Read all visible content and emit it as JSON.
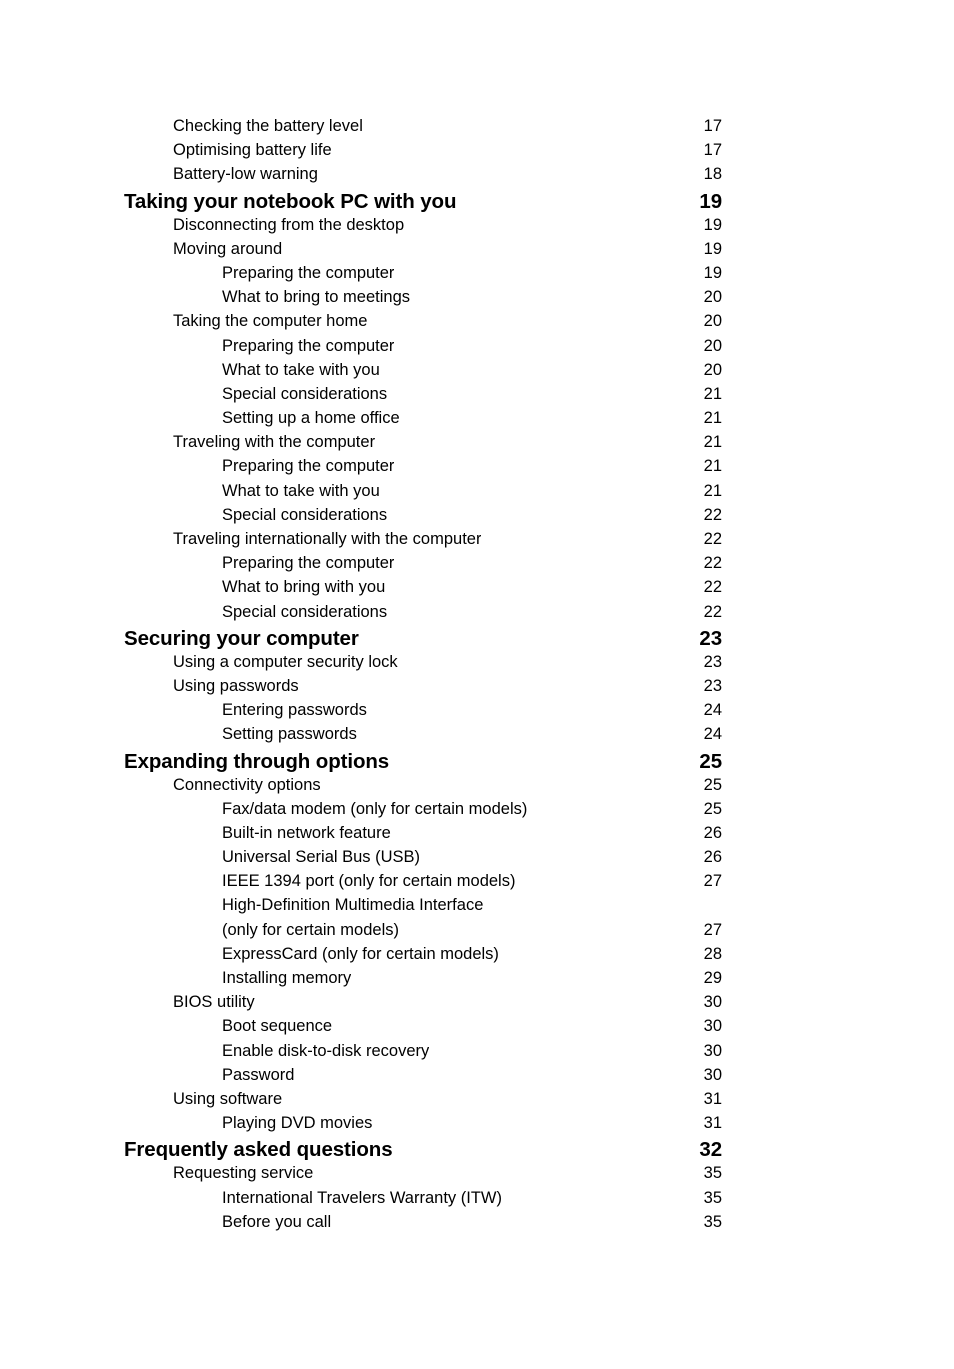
{
  "document": {
    "type": "table-of-contents",
    "text_color": "#000000",
    "background_color": "#ffffff"
  },
  "toc": {
    "entries": [
      {
        "level": 2,
        "title": "Checking the battery level",
        "page": "17"
      },
      {
        "level": 2,
        "title": "Optimising battery life",
        "page": "17"
      },
      {
        "level": 2,
        "title": "Battery-low warning",
        "page": "18"
      },
      {
        "level": 1,
        "title": "Taking your notebook PC with you",
        "page": "19"
      },
      {
        "level": 2,
        "title": "Disconnecting from the desktop",
        "page": "19"
      },
      {
        "level": 2,
        "title": "Moving around",
        "page": "19"
      },
      {
        "level": 3,
        "title": "Preparing the computer",
        "page": "19"
      },
      {
        "level": 3,
        "title": "What to bring to meetings",
        "page": "20"
      },
      {
        "level": 2,
        "title": "Taking the computer home",
        "page": "20"
      },
      {
        "level": 3,
        "title": "Preparing the computer",
        "page": "20"
      },
      {
        "level": 3,
        "title": "What to take with you",
        "page": "20"
      },
      {
        "level": 3,
        "title": "Special considerations",
        "page": "21"
      },
      {
        "level": 3,
        "title": "Setting up a home office",
        "page": "21"
      },
      {
        "level": 2,
        "title": "Traveling with the computer",
        "page": "21"
      },
      {
        "level": 3,
        "title": "Preparing the computer",
        "page": "21"
      },
      {
        "level": 3,
        "title": "What to take with you",
        "page": "21"
      },
      {
        "level": 3,
        "title": "Special considerations",
        "page": "22"
      },
      {
        "level": 2,
        "title": "Traveling internationally with the computer",
        "page": "22"
      },
      {
        "level": 3,
        "title": "Preparing the computer",
        "page": "22"
      },
      {
        "level": 3,
        "title": "What to bring with you",
        "page": "22"
      },
      {
        "level": 3,
        "title": "Special considerations",
        "page": "22"
      },
      {
        "level": 1,
        "title": "Securing your computer",
        "page": "23"
      },
      {
        "level": 2,
        "title": "Using a computer security lock",
        "page": "23"
      },
      {
        "level": 2,
        "title": "Using passwords",
        "page": "23"
      },
      {
        "level": 3,
        "title": "Entering passwords",
        "page": "24"
      },
      {
        "level": 3,
        "title": "Setting passwords",
        "page": "24"
      },
      {
        "level": 1,
        "title": "Expanding through options",
        "page": "25"
      },
      {
        "level": 2,
        "title": "Connectivity options",
        "page": "25"
      },
      {
        "level": 3,
        "title": "Fax/data modem (only for certain models)",
        "page": "25"
      },
      {
        "level": 3,
        "title": "Built-in network feature",
        "page": "26"
      },
      {
        "level": 3,
        "title": "Universal Serial Bus (USB)",
        "page": "26"
      },
      {
        "level": 3,
        "title": "IEEE 1394 port  (only for certain models)",
        "page": "27"
      },
      {
        "level": 3,
        "title": "High-Definition Multimedia Interface",
        "page": "",
        "wrapped": true
      },
      {
        "level": 3,
        "title": "(only for certain models)",
        "page": "27"
      },
      {
        "level": 3,
        "title": "ExpressCard (only for certain models)",
        "page": "28"
      },
      {
        "level": 3,
        "title": "Installing memory",
        "page": "29"
      },
      {
        "level": 2,
        "title": "BIOS utility",
        "page": "30"
      },
      {
        "level": 3,
        "title": "Boot sequence",
        "page": "30"
      },
      {
        "level": 3,
        "title": "Enable disk-to-disk recovery",
        "page": "30"
      },
      {
        "level": 3,
        "title": "Password",
        "page": "30"
      },
      {
        "level": 2,
        "title": "Using software",
        "page": "31"
      },
      {
        "level": 3,
        "title": "Playing DVD movies",
        "page": "31"
      },
      {
        "level": 1,
        "title": "Frequently asked questions",
        "page": "32"
      },
      {
        "level": 2,
        "title": "Requesting service",
        "page": "35"
      },
      {
        "level": 3,
        "title": "International Travelers Warranty (ITW)",
        "page": "35"
      },
      {
        "level": 3,
        "title": "Before you call",
        "page": "35"
      }
    ]
  }
}
